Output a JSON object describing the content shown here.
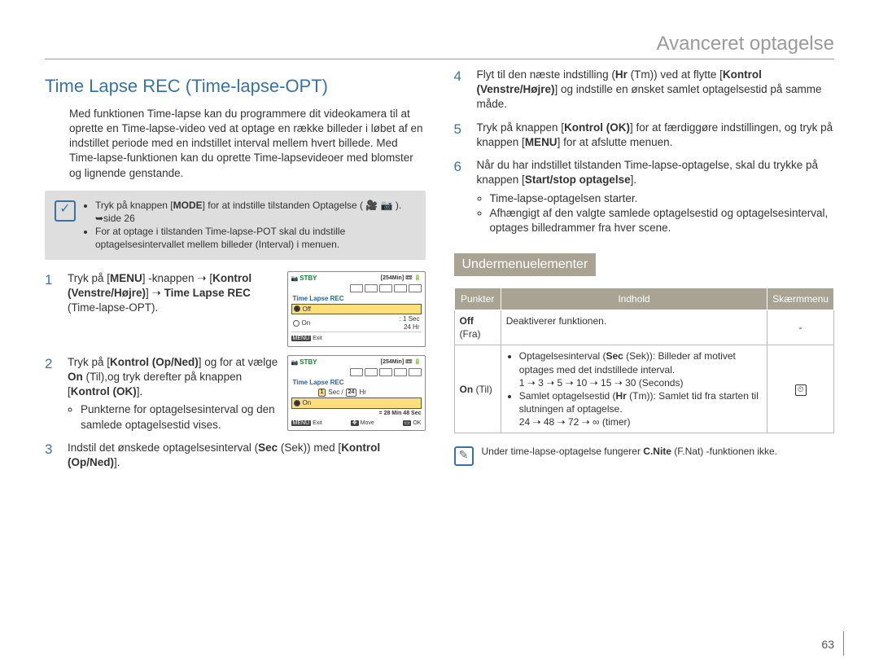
{
  "header": {
    "section": "Avanceret optagelse"
  },
  "title": "Time Lapse REC (Time-lapse-OPT)",
  "intro": "Med funktionen Time-lapse kan du programmere dit videokamera til at oprette en Time-lapse-video ved at optage en række billeder i løbet af en indstillet periode med en indstillet interval mellem hvert billede. Med Time-lapse-funktionen kan du oprette Time-lapsevideoer med blomster og lignende genstande.",
  "note": {
    "b1a": "Tryk på knappen [",
    "b1b": "MODE",
    "b1c": "] for at indstille tilstanden Optagelse ( 🎥 📷 ). ➥side 26",
    "b2": "For at optage i tilstanden Time-lapse-POT skal du indstille optagelsesintervallet mellem billeder (Interval) i menuen."
  },
  "steps_left": {
    "s1a": "Tryk på [",
    "s1b": "MENU",
    "s1c": "] -knappen ➝ [",
    "s1d": "Kontrol (Venstre/Højre)",
    "s1e": "] ➝ ",
    "s1f": "Time Lapse REC",
    "s1g": " (Time-lapse-OPT).",
    "s2a": "Tryk på [",
    "s2b": "Kontrol (Op/Ned)",
    "s2c": "] og for at vælge ",
    "s2d": "On",
    "s2e": " (Til),og tryk derefter på knappen [",
    "s2f": "Kontrol (OK)",
    "s2g": "].",
    "s2_bullet": "Punkterne for optagelsesinterval og den samlede optagelsestid vises.",
    "s3a": "Indstil det ønskede optagelsesinterval (",
    "s3b": "Sec",
    "s3c": " (Sek)) med [",
    "s3d": "Kontrol (Op/Ned)",
    "s3e": "]."
  },
  "steps_right": {
    "s4a": "Flyt til den næste indstilling (",
    "s4b": "Hr",
    "s4c": " (Tm)) ved at flytte [",
    "s4d": "Kontrol (Venstre/Højre)",
    "s4e": "] og indstille en ønsket samlet optagelsestid på samme måde.",
    "s5a": "Tryk på knappen [",
    "s5b": "Kontrol (OK)",
    "s5c": "] for at færdiggøre indstillingen, og tryk på knappen [",
    "s5d": "MENU",
    "s5e": "] for at afslutte menuen.",
    "s6a": "Når du har indstillet tilstanden Time-lapse-optagelse, skal du trykke på knappen [",
    "s6b": "Start/stop optagelse",
    "s6c": "].",
    "s6_b1": "Time-lapse-optagelsen starter.",
    "s6_b2": "Afhængigt af den valgte samlede optagelsestid og optagelsesinterval, optages billedrammer fra hver scene."
  },
  "lcd1": {
    "stby": "STBY",
    "mins": "[254Min]",
    "title": "Time Lapse REC",
    "off": "Off",
    "on": "On",
    "sec": ": 1 Sec",
    "hr": "  24 Hr",
    "exit": "Exit",
    "menu": "MENU"
  },
  "lcd2": {
    "stby": "STBY",
    "mins": "[254Min]",
    "title": "Time Lapse REC",
    "sec_val": "1",
    "sec_lbl": "Sec /",
    "hr_val": "24",
    "hr_lbl": "Hr",
    "on": "On",
    "eta": "= 28 Min 48 Sec",
    "menu": "MENU",
    "exit": "Exit",
    "move": "Move",
    "ok": "OK"
  },
  "submenu_heading": "Undermenuelementer",
  "table": {
    "h1": "Punkter",
    "h2": "Indhold",
    "h3": "Skærmmenu",
    "r1c1a": "Off",
    "r1c1b": " (Fra)",
    "r1c2": "Deaktiverer funktionen.",
    "r1c3": "-",
    "r2c1a": "On",
    "r2c1b": " (Til)",
    "r2b1a": "Optagelsesinterval (",
    "r2b1b": "Sec",
    "r2b1c": " (Sek)): Billeder af motivet optages med det indstillede interval.",
    "r2b1d": "1 ➝ 3 ➝ 5 ➝ 10 ➝ 15 ➝ 30 (Seconds)",
    "r2b2a": "Samlet optagelsestid (",
    "r2b2b": "Hr",
    "r2b2c": " (Tm)): Samlet tid fra starten til slutningen af optagelse.",
    "r2b2d": "24 ➝ 48 ➝ 72 ➝ ∞ (timer)"
  },
  "note2a": "Under time-lapse-optagelse fungerer ",
  "note2b": "C.Nite",
  "note2c": " (F.Nat) -funktionen ikke.",
  "page": "63"
}
